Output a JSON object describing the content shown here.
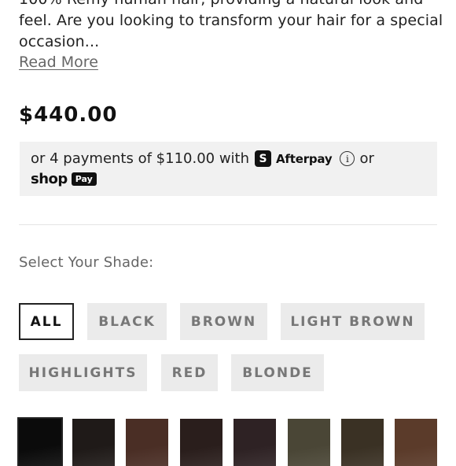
{
  "description": {
    "line1": "100% Remy human hair, providing a natural look and",
    "line2": "feel.  Are you looking to transform your hair for a special",
    "line3": "occasion...",
    "read_more": "Read More"
  },
  "price": "$440.00",
  "payments": {
    "prefix": "or 4 payments of $110.00 with",
    "afterpay_icon": "S",
    "afterpay_word": "Afterpay",
    "info_icon": "i",
    "or": "or",
    "shop_word": "shop",
    "pay_pill": "Pay"
  },
  "shade_label": "Select Your Shade:",
  "filters": [
    {
      "label": "ALL",
      "active": true
    },
    {
      "label": "BLACK"
    },
    {
      "label": "BROWN"
    },
    {
      "label": "LIGHT BROWN"
    },
    {
      "label": "HIGHLIGHTS"
    },
    {
      "label": "RED"
    },
    {
      "label": "BLONDE"
    }
  ],
  "swatches": [
    {
      "color": "#0b0b0b",
      "active": true
    },
    {
      "color": "#1f1a18"
    },
    {
      "color": "#4a2e25"
    },
    {
      "color": "#2a1e1c"
    },
    {
      "color": "#2e2224"
    },
    {
      "color": "#4a4636"
    },
    {
      "color": "#3a3124"
    },
    {
      "color": "#5b3b2a"
    }
  ]
}
